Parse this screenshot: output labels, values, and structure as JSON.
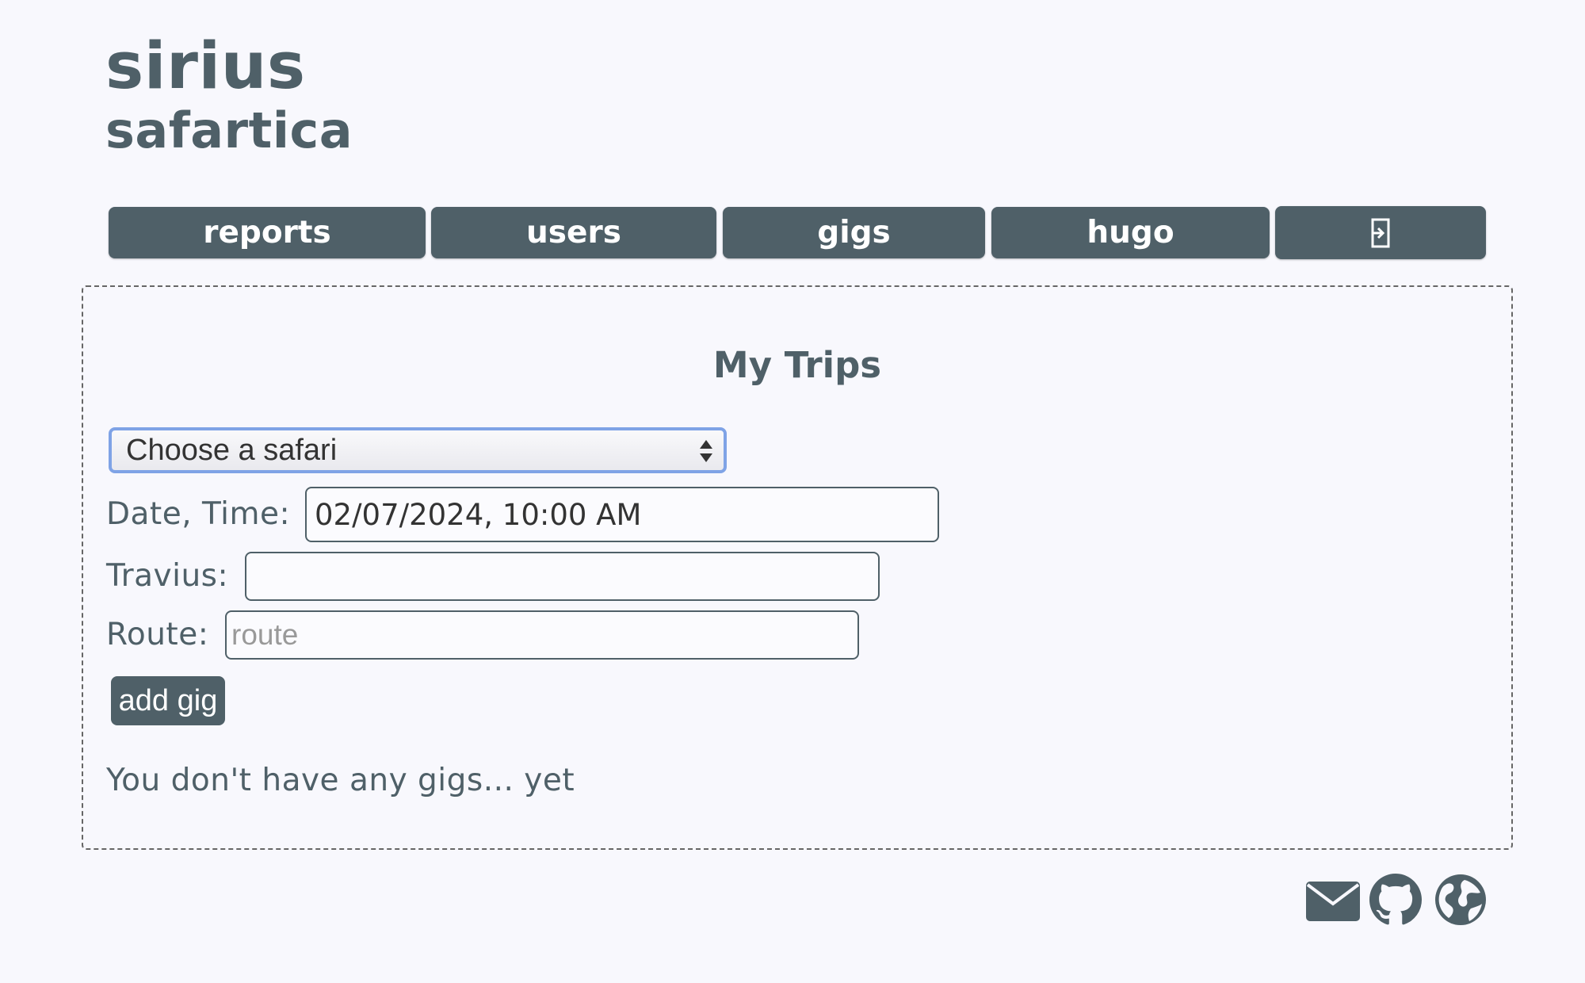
{
  "brand": {
    "line1": "sirius",
    "line2": "safartica"
  },
  "nav": {
    "items": [
      {
        "label": "reports"
      },
      {
        "label": "users"
      },
      {
        "label": "gigs"
      },
      {
        "label": "hugo"
      },
      {
        "label": "",
        "icon": "logout-icon"
      }
    ]
  },
  "main": {
    "title": "My Trips",
    "safari_select": {
      "selected": "Choose a safari"
    },
    "form": {
      "date_label": "Date, Time:",
      "date_value": "02/07/2024, 10:00 AM",
      "travius_label": "Travius:",
      "travius_value": "",
      "route_label": "Route:",
      "route_placeholder": "route",
      "add_button": "add gig"
    },
    "empty_message": "You don't have any gigs... yet"
  },
  "footer": {
    "icons": [
      "envelope-icon",
      "github-icon",
      "globe-icon"
    ]
  },
  "colors": {
    "primary": "#4f6068",
    "background": "#f8f8fd",
    "focus": "#7fa3e6"
  }
}
